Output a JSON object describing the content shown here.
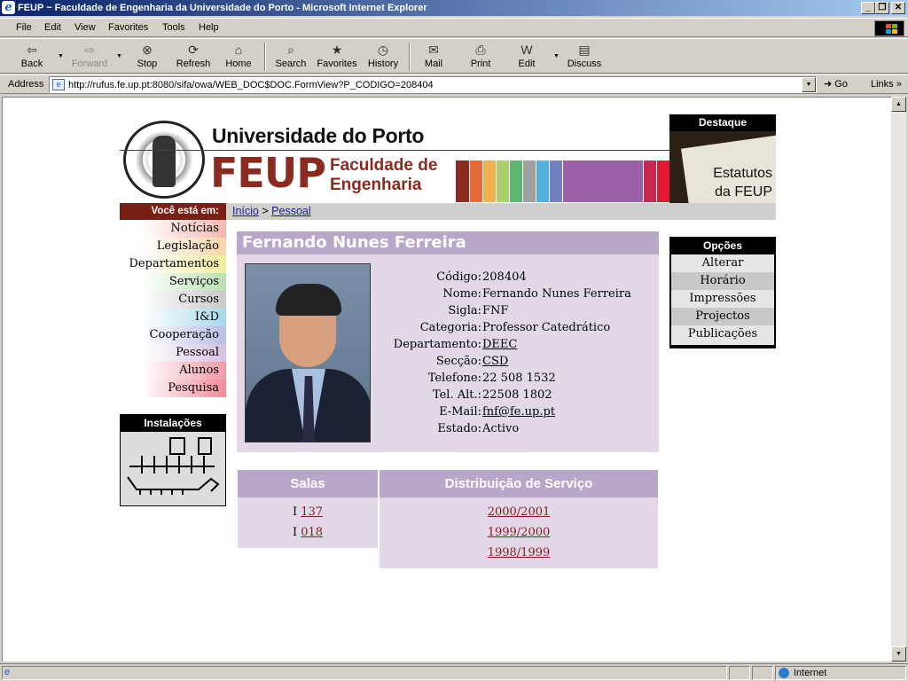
{
  "window": {
    "title": "FEUP ~ Faculdade de Engenharia da Universidade do Porto - Microsoft Internet Explorer",
    "min_glyph": "_",
    "max_glyph": "❐",
    "close_glyph": "✕"
  },
  "menu": [
    "File",
    "Edit",
    "View",
    "Favorites",
    "Tools",
    "Help"
  ],
  "toolbar": {
    "back": "Back",
    "forward": "Forward",
    "stop": "Stop",
    "refresh": "Refresh",
    "home": "Home",
    "search": "Search",
    "favorites": "Favorites",
    "history": "History",
    "mail": "Mail",
    "print": "Print",
    "edit": "Edit",
    "discuss": "Discuss"
  },
  "address": {
    "label": "Address",
    "url": "http://rufus.fe.up.pt:8080/sifa/owa/WEB_DOC$DOC.FormView?P_CODIGO=208404",
    "go": "Go",
    "links": "Links"
  },
  "status": {
    "zone": "Internet"
  },
  "page": {
    "university": "Universidade do Porto",
    "feup": "FEUP",
    "faculty_line1": "Faculdade de",
    "faculty_line2": "Engenharia",
    "destaque": {
      "title": "Destaque",
      "line1": "Estatutos",
      "line2": "da FEUP"
    },
    "voce_esta_em": "Você está em:",
    "breadcrumb": {
      "home": "Início",
      "sep": ">",
      "current": "Pessoal"
    },
    "nav": [
      "Notícias",
      "Legislação",
      "Departamentos",
      "Serviços",
      "Cursos",
      "I&D",
      "Cooperação",
      "Pessoal",
      "Alunos",
      "Pesquisa"
    ],
    "nav_colors": [
      "#f4b8b0",
      "#f7d5a6",
      "#f3eda0",
      "#b9e0b0",
      "#c8c8c8",
      "#a8d8ee",
      "#b8bfe4",
      "#d8c0e2",
      "#ee9aa8",
      "#f28a98"
    ],
    "instalacoes": "Instalações",
    "person": {
      "name": "Fernando Nunes Ferreira",
      "fields": [
        {
          "label": "Código:",
          "value": "208404"
        },
        {
          "label": "Nome:",
          "value": "Fernando Nunes Ferreira"
        },
        {
          "label": "Sigla:",
          "value": "FNF"
        },
        {
          "label": "Categoria:",
          "value": "Professor Catedrático"
        },
        {
          "label": "Departamento:",
          "value": "DEEC"
        },
        {
          "label": "Secção:",
          "value": "CSD"
        },
        {
          "label": "Telefone:",
          "value": "22 508 1532"
        },
        {
          "label": "Tel. Alt.:",
          "value": "22508 1802"
        },
        {
          "label": "E-Mail:",
          "value": "fnf@fe.up.pt"
        },
        {
          "label": "Estado:",
          "value": "Activo"
        }
      ]
    },
    "salas": {
      "title": "Salas",
      "rows": [
        {
          "prefix": "I",
          "room": "137"
        },
        {
          "prefix": "I",
          "room": "018"
        }
      ]
    },
    "distribuicao": {
      "title": "Distribuição de Serviço",
      "years": [
        "2000/2001",
        "1999/2000",
        "1998/1999"
      ]
    },
    "opcoes": {
      "title": "Opções",
      "items": [
        "Alterar",
        "Horário",
        "Impressões",
        "Projectos",
        "Publicações"
      ]
    }
  },
  "colors": {
    "feup_red": "#8b2a1e",
    "lilac_header": "#b9a7c9",
    "lilac_box": "#e2d8e8"
  }
}
